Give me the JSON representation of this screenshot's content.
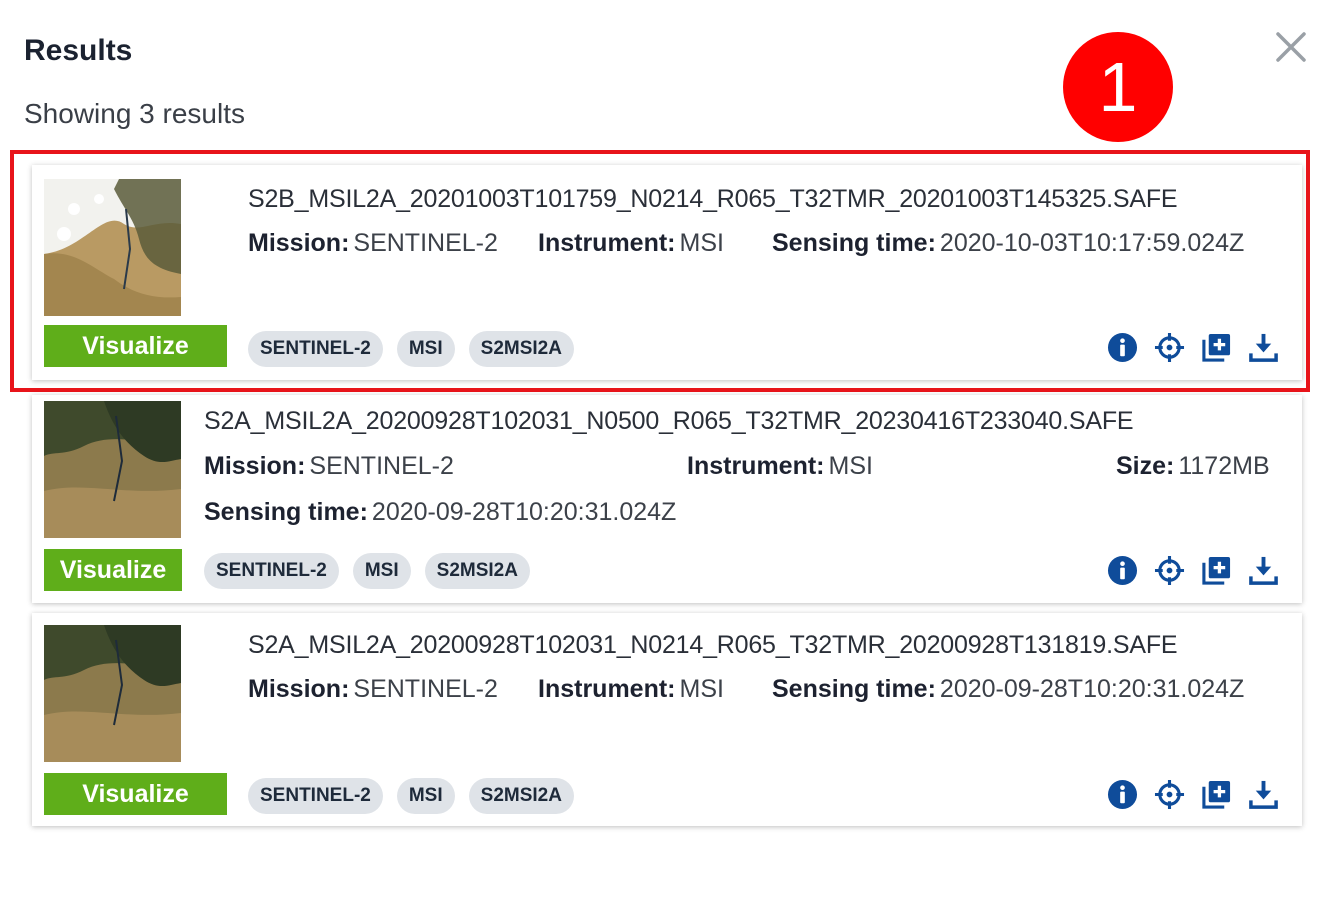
{
  "header": {
    "title": "Results",
    "count_text": "Showing 3 results",
    "close_icon": "close-icon",
    "step_number": "1"
  },
  "labels": {
    "mission": "Mission:",
    "instrument": "Instrument:",
    "sensing_time": "Sensing time:",
    "size": "Size:",
    "visualize": "Visualize"
  },
  "results": [
    {
      "filename": "S2B_MSIL2A_20201003T101759_N0214_R065_T32TMR_20201003T145325.SAFE",
      "mission": "SENTINEL-2",
      "instrument": "MSI",
      "sensing_time": "2020-10-03T10:17:59.024Z",
      "tags": [
        "SENTINEL-2",
        "MSI",
        "S2MSI2A"
      ]
    },
    {
      "filename": "S2A_MSIL2A_20200928T102031_N0500_R065_T32TMR_20230416T233040.SAFE",
      "mission": "SENTINEL-2",
      "instrument": "MSI",
      "size": "1172MB",
      "sensing_time": "2020-09-28T10:20:31.024Z",
      "tags": [
        "SENTINEL-2",
        "MSI",
        "S2MSI2A"
      ]
    },
    {
      "filename": "S2A_MSIL2A_20200928T102031_N0214_R065_T32TMR_20200928T131819.SAFE",
      "mission": "SENTINEL-2",
      "instrument": "MSI",
      "sensing_time": "2020-09-28T10:20:31.024Z",
      "tags": [
        "SENTINEL-2",
        "MSI",
        "S2MSI2A"
      ]
    }
  ],
  "action_icons": [
    "info-icon",
    "locate-icon",
    "add-to-layers-icon",
    "download-icon"
  ],
  "colors": {
    "accent_green": "#5fae1a",
    "icon_blue": "#0f4c9a",
    "highlight_red": "#e8141a",
    "tag_bg": "#dfe3e8"
  }
}
